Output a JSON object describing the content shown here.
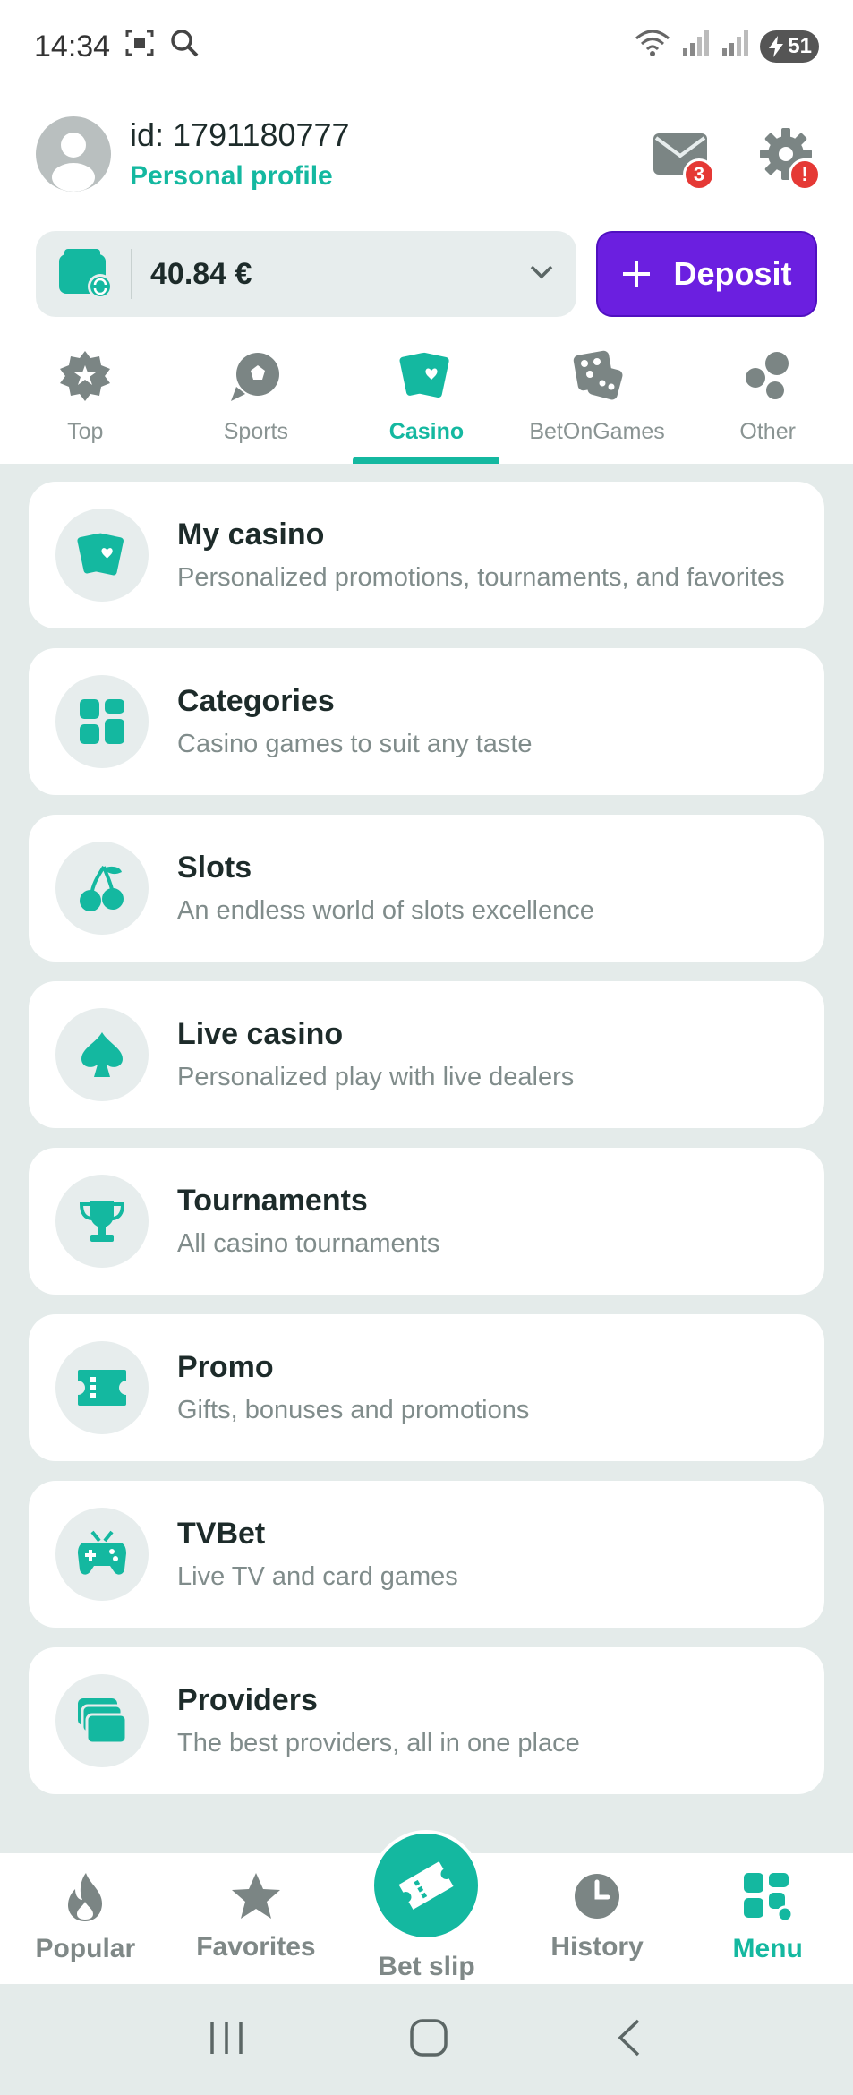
{
  "status_bar": {
    "time": "14:34",
    "battery": "51"
  },
  "profile": {
    "user_id": "id: 1791180777",
    "profile_link": "Personal profile",
    "mail_badge": "3",
    "settings_badge": "!"
  },
  "balance": {
    "amount": "40.84 €",
    "deposit_label": "Deposit"
  },
  "tabs": [
    {
      "label": "Top",
      "icon": "badge-star-icon"
    },
    {
      "label": "Sports",
      "icon": "soccer-ball-icon"
    },
    {
      "label": "Casino",
      "icon": "cards-icon"
    },
    {
      "label": "BetOnGames",
      "icon": "dice-icon"
    },
    {
      "label": "Other",
      "icon": "bubbles-icon"
    }
  ],
  "menu_items": [
    {
      "title": "My casino",
      "subtitle": "Personalized promotions, tournaments, and favorites",
      "icon": "cards-icon"
    },
    {
      "title": "Categories",
      "subtitle": "Casino games to suit any taste",
      "icon": "grid-icon"
    },
    {
      "title": "Slots",
      "subtitle": "An endless world of slots excellence",
      "icon": "cherry-icon"
    },
    {
      "title": "Live casino",
      "subtitle": "Personalized play with live dealers",
      "icon": "spade-icon"
    },
    {
      "title": "Tournaments",
      "subtitle": "All casino tournaments",
      "icon": "trophy-icon"
    },
    {
      "title": "Promo",
      "subtitle": "Gifts, bonuses and promotions",
      "icon": "ticket-icon"
    },
    {
      "title": "TVBet",
      "subtitle": "Live TV and card games",
      "icon": "tv-gamepad-icon"
    },
    {
      "title": "Providers",
      "subtitle": "The best providers, all in one place",
      "icon": "stack-icon"
    }
  ],
  "bottom_nav": [
    {
      "label": "Popular",
      "icon": "flame-icon"
    },
    {
      "label": "Favorites",
      "icon": "star-icon"
    },
    {
      "label": "Bet slip",
      "icon": "ticket-icon"
    },
    {
      "label": "History",
      "icon": "clock-icon"
    },
    {
      "label": "Menu",
      "icon": "menu-grid-icon"
    }
  ],
  "colors": {
    "accent": "#14b8a0",
    "deposit": "#6b1fe0",
    "background": "#e4ebea",
    "badge": "#e53935"
  }
}
